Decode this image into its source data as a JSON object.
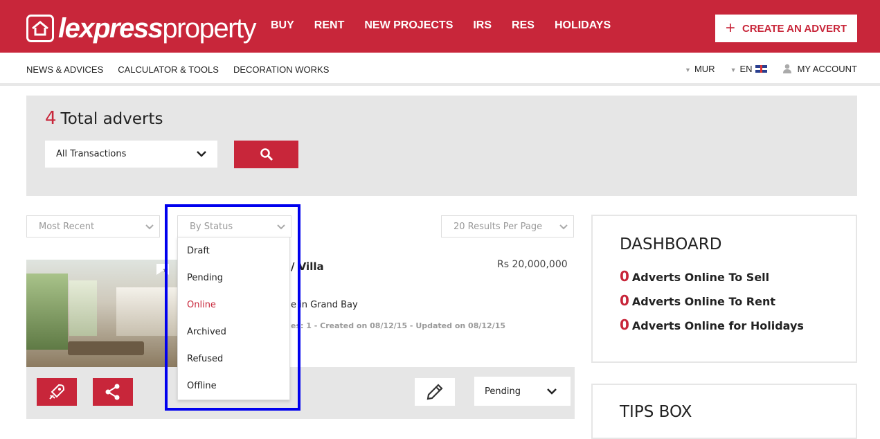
{
  "header": {
    "logo": {
      "bold": "lexpress",
      "light": "property"
    },
    "nav": [
      "BUY",
      "RENT",
      "NEW PROJECTS",
      "IRS",
      "RES",
      "HOLIDAYS"
    ],
    "create_advert": "CREATE AN ADVERT"
  },
  "subnav": {
    "links": [
      "NEWS & ADVICES",
      "CALCULATOR & TOOLS",
      "DECORATION WORKS"
    ],
    "currency": "MUR",
    "language": "EN",
    "account": "MY ACCOUNT"
  },
  "search": {
    "total_count": "4",
    "total_label": "Total adverts",
    "transaction_select": "All Transactions"
  },
  "filters": {
    "sort": "Most Recent",
    "status": "By Status",
    "per_page": "20 Results Per Page"
  },
  "status_dropdown": {
    "options": [
      "Draft",
      "Pending",
      "Online",
      "Archived",
      "Refused",
      "Offline"
    ],
    "active_index": 2
  },
  "listing": {
    "title": "/ Villa",
    "price": "Rs 20,000,000",
    "location": "e in Grand Bay",
    "meta": "es: 1 - Created on 08/12/15 - Updated on 08/12/15",
    "status": "Pending"
  },
  "dashboard": {
    "title": "DASHBOARD",
    "stats": [
      {
        "count": "0",
        "label": "Adverts Online To Sell"
      },
      {
        "count": "0",
        "label": "Adverts Online To Rent"
      },
      {
        "count": "0",
        "label": "Adverts Online for Holidays"
      }
    ]
  },
  "tips": {
    "title": "TIPS BOX"
  },
  "colors": {
    "brand": "#c8263a",
    "highlight": "#0000ee",
    "panel": "#e6e6e6"
  }
}
